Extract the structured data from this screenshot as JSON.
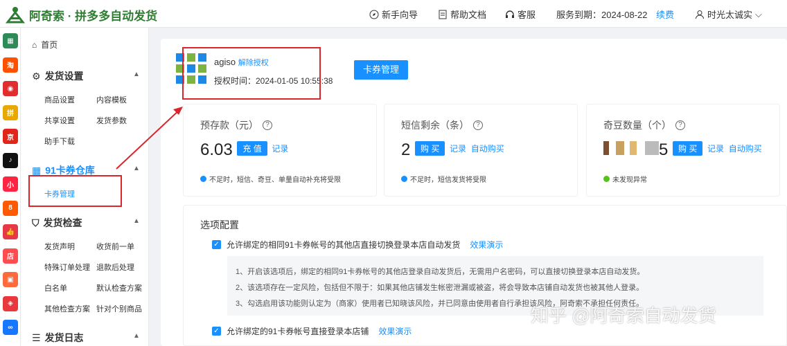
{
  "header": {
    "brand": "阿奇索 · 拼多多自动发货",
    "guide": "新手向导",
    "docs": "帮助文档",
    "service": "客服",
    "expiry_label": "服务到期：2024-08-22",
    "renew": "续费",
    "user": "时光太诚实"
  },
  "rail": [
    {
      "icon": "grid-icon",
      "color": "#2e8b57",
      "glyph": "▦"
    },
    {
      "icon": "taobao-icon",
      "color": "#ff5000",
      "glyph": "淘"
    },
    {
      "icon": "shop-icon",
      "color": "#e02e2e",
      "glyph": "◉"
    },
    {
      "icon": "pdd-icon",
      "color": "#e8a800",
      "glyph": "拼"
    },
    {
      "icon": "jd-icon",
      "color": "#e1251b",
      "glyph": "京"
    },
    {
      "icon": "douyin-icon",
      "color": "#111111",
      "glyph": "♪"
    },
    {
      "icon": "xiaohongshu-icon",
      "color": "#ff2442",
      "glyph": "小"
    },
    {
      "icon": "kuaishou-icon",
      "color": "#ff5a00",
      "glyph": "8"
    },
    {
      "icon": "like-icon",
      "color": "#e63946",
      "glyph": "👍"
    },
    {
      "icon": "store-icon",
      "color": "#ff4d4f",
      "glyph": "店"
    },
    {
      "icon": "bag-icon",
      "color": "#ff6a3d",
      "glyph": "▣"
    },
    {
      "icon": "tag-icon",
      "color": "#e8383d",
      "glyph": "◈"
    },
    {
      "icon": "link-icon",
      "color": "#1677ff",
      "glyph": "∞"
    }
  ],
  "sidebar": {
    "home": "首页",
    "ship_settings": "发货设置",
    "ship_items": [
      "商品设置",
      "内容模板",
      "共享设置",
      "发货参数",
      "助手下载"
    ],
    "warehouse": "91卡券仓库",
    "card_mgmt": "卡券管理",
    "ship_check": "发货检查",
    "check_items": [
      "发货声明",
      "收货前一单",
      "特殊订单处理",
      "退款后处理",
      "白名单",
      "默认检查方案",
      "其他检查方案",
      "针对个别商品"
    ],
    "ship_log": "发货日志"
  },
  "account": {
    "name": "agiso",
    "unbind": "解除授权",
    "auth_time": "授权时间：2024-01-05 10:55:38",
    "manage_button": "卡券管理"
  },
  "cards": [
    {
      "title": "预存款（元）",
      "value": "6.03",
      "btn": "充 值",
      "links": [
        "记录"
      ],
      "note": "不足时，短信、奇豆、单量自动补充将受限",
      "note_color": "#1890ff"
    },
    {
      "title": "短信剩余（条）",
      "value": "2",
      "btn": "购 买",
      "links": [
        "记录",
        "自动购买"
      ],
      "note": "不足时，短信发货将受限",
      "note_color": "#1890ff"
    },
    {
      "title": "奇豆数量（个）",
      "value": "5",
      "btn": "购 买",
      "links": [
        "记录",
        "自动购买"
      ],
      "note": "未发现异常",
      "note_color": "#52c41a"
    }
  ],
  "options": {
    "title": "选项配置",
    "opt1": "允许绑定的相同91卡券帐号的其他店直接切换登录本店自动发货",
    "demo": "效果演示",
    "desc": [
      "1、开启该选项后，绑定的相同91卡券帐号的其他店登录自动发货后，无需用户名密码，可以直接切换登录本店自动发货。",
      "2、该选项存在一定风险，包括但不限于：如果其他店铺发生帐密泄漏或被盗，将会导致本店铺自动发货也被其他人登录。",
      "3、勾选启用该功能则认定为（商家）使用者已知晓该风险，并已同意由使用者自行承担该风险，阿奇索不承担任何责任。"
    ],
    "opt2": "允许绑定的91卡券帐号直接登录本店铺",
    "demo2": "效果演示"
  },
  "watermark": "知乎 @阿奇索自动发货"
}
